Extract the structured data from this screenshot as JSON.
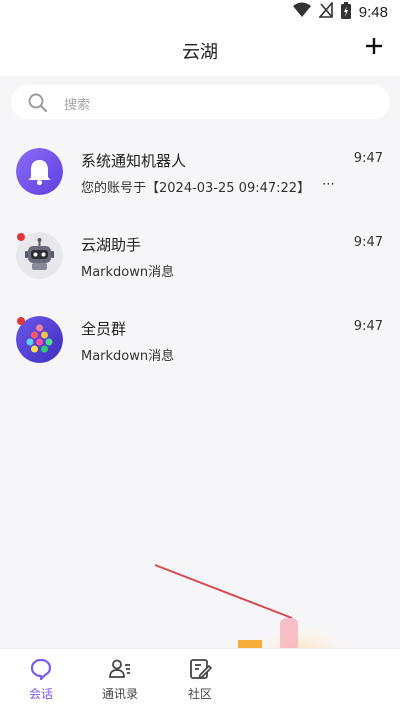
{
  "status_bar": {
    "time": "9:48",
    "icons": [
      "wifi-icon",
      "signal-icon",
      "battery-icon"
    ]
  },
  "header": {
    "title": "云湖",
    "add_icon": "plus-icon"
  },
  "search": {
    "placeholder": "搜索"
  },
  "conversations": [
    {
      "title": "系统通知机器人",
      "preview": "您的账号于【2024-03-25 09:47:22】",
      "more": "⋯",
      "time": "9:47",
      "unread": false,
      "avatar": "bell-avatar"
    },
    {
      "title": "云湖助手",
      "preview": "Markdown消息",
      "time": "9:47",
      "unread": true,
      "avatar": "robot-avatar"
    },
    {
      "title": "全员群",
      "preview": "Markdown消息",
      "time": "9:47",
      "unread": true,
      "avatar": "group-avatar"
    }
  ],
  "tabbar": {
    "tabs": [
      {
        "label": "会话",
        "icon": "chat-bubble-icon",
        "active": true
      },
      {
        "label": "通讯录",
        "icon": "contacts-icon",
        "active": false
      },
      {
        "label": "社区",
        "icon": "community-icon",
        "active": false
      }
    ]
  },
  "colors": {
    "accent": "#7b5cf0",
    "unread_badge": "#e2383c",
    "background": "#f6f6f8"
  }
}
